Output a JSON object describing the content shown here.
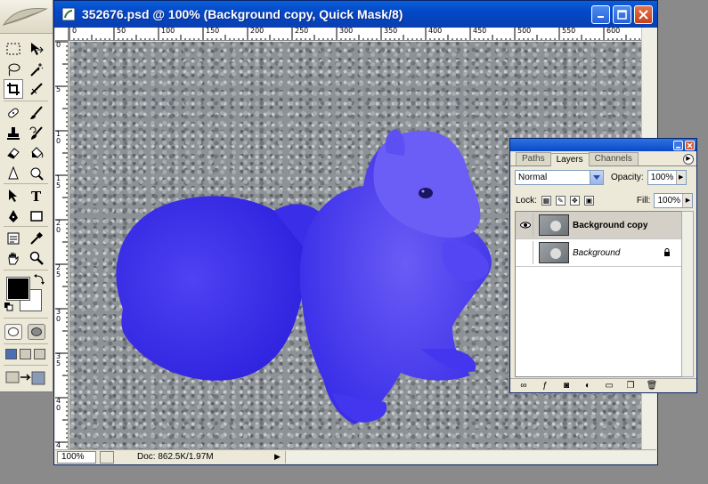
{
  "document": {
    "title": "352676.psd @ 100% (Background copy, Quick Mask/8)",
    "zoom": "100%",
    "doc_info": "Doc: 862.5K/1.97M",
    "ruler_h": [
      "0",
      "50",
      "100",
      "150",
      "200",
      "250",
      "300",
      "350",
      "400",
      "450",
      "500",
      "550",
      "600"
    ],
    "ruler_v": [
      "0",
      "5",
      "1 0",
      "1 5",
      "2 0",
      "2 5",
      "3 0",
      "3 5",
      "4 0",
      "4"
    ],
    "quick_mask_color": "#4a3cf0"
  },
  "layers_panel": {
    "tabs": [
      "Paths",
      "Layers",
      "Channels"
    ],
    "active_tab": "Layers",
    "blend_mode": "Normal",
    "opacity_label": "Opacity:",
    "opacity": "100%",
    "lock_label": "Lock:",
    "fill_label": "Fill:",
    "fill": "100%",
    "layers": [
      {
        "name": "Background copy",
        "visible": true,
        "selected": true,
        "locked": false
      },
      {
        "name": "Background",
        "visible": false,
        "selected": false,
        "locked": true
      }
    ]
  },
  "toolbox": {
    "tools": [
      "marquee-tool",
      "move-tool",
      "lasso-tool",
      "magic-wand-tool",
      "crop-tool",
      "slice-tool",
      "healing-brush-tool",
      "brush-tool",
      "clone-stamp-tool",
      "history-brush-tool",
      "eraser-tool",
      "paint-bucket-tool",
      "sharpen-tool",
      "dodge-tool",
      "path-selection-tool",
      "type-tool",
      "pen-tool",
      "rectangle-tool",
      "notes-tool",
      "eyedropper-tool",
      "hand-tool",
      "zoom-tool"
    ],
    "foreground_color": "#000000",
    "background_color": "#ffffff"
  }
}
